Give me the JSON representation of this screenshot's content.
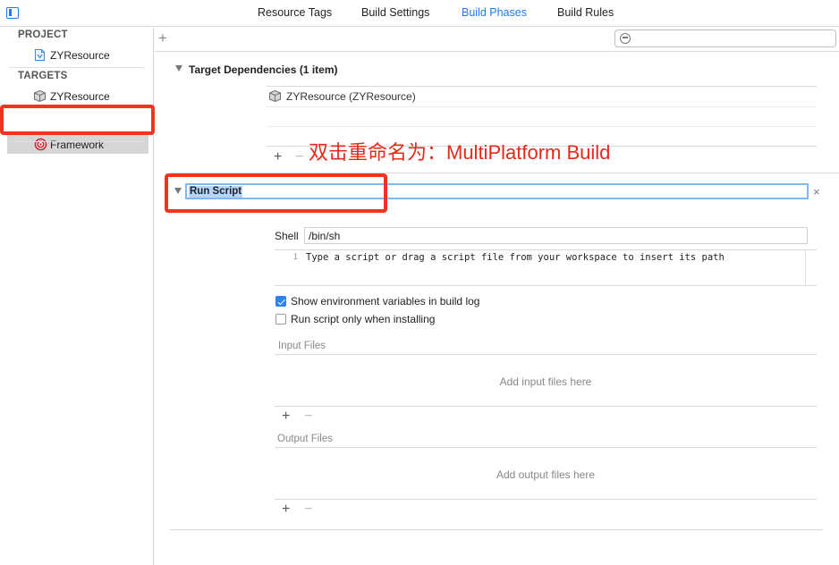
{
  "tabs": [
    {
      "label": "Resource Tags",
      "active": false
    },
    {
      "label": "Build Settings",
      "active": false
    },
    {
      "label": "Build Phases",
      "active": true
    },
    {
      "label": "Build Rules",
      "active": false
    }
  ],
  "sidebar": {
    "project_header": "PROJECT",
    "project_items": [
      {
        "label": "ZYResource",
        "icon": "project-file-icon"
      }
    ],
    "targets_header": "TARGETS",
    "target_items": [
      {
        "label": "ZYResource",
        "icon": "app-target-icon"
      },
      {
        "label": "Framework",
        "icon": "framework-target-icon",
        "selected": true
      }
    ]
  },
  "main": {
    "add_phase_label": "+",
    "filter_placeholder": "",
    "target_dependencies": {
      "title": "Target Dependencies (1 item)",
      "items": [
        {
          "label": "ZYResource (ZYResource)",
          "icon": "app-target-icon"
        }
      ],
      "add_label": "+",
      "remove_label": "−"
    },
    "annotation": "双击重命名为：MultiPlatform Build",
    "run_script": {
      "title": "Run Script",
      "close_label": "×",
      "shell_label": "Shell",
      "shell_value": "/bin/sh",
      "line_number": "1",
      "script_text": "Type a script or drag a script file from your workspace to insert its path",
      "options": [
        {
          "label": "Show environment variables in build log",
          "checked": true
        },
        {
          "label": "Run script only when installing",
          "checked": false
        }
      ],
      "input_files": {
        "label": "Input Files",
        "placeholder": "Add input files here",
        "add_label": "+",
        "remove_label": "−"
      },
      "output_files": {
        "label": "Output Files",
        "placeholder": "Add output files here",
        "add_label": "+",
        "remove_label": "−"
      }
    }
  },
  "colors": {
    "accent": "#1a7cf5",
    "annotation_red": "#e8271b",
    "selection": "#b5d5fb"
  }
}
